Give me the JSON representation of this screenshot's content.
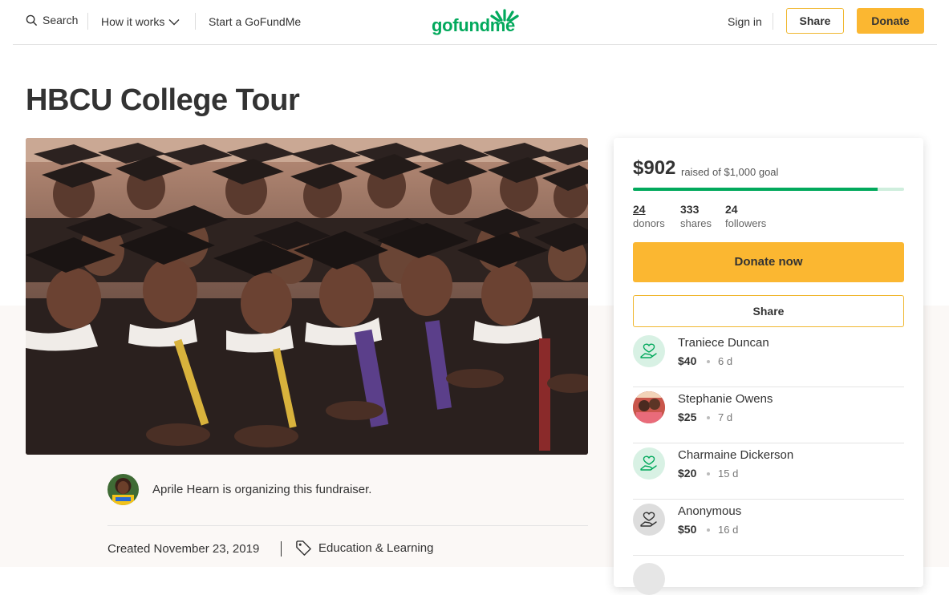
{
  "header": {
    "search_label": "Search",
    "how_it_works_label": "How it works",
    "start_label": "Start a GoFundMe",
    "logo_text": "gofundme",
    "sign_in_label": "Sign in",
    "share_label": "Share",
    "donate_label": "Donate"
  },
  "campaign": {
    "title": "HBCU College Tour",
    "organizer_text": "Aprile Hearn is organizing this fundraiser.",
    "created": "Created November 23, 2019",
    "category": "Education & Learning"
  },
  "sidebar": {
    "raised_amount": "$902",
    "raised_of": "raised of $1,000 goal",
    "progress_fraction": 0.902,
    "stats": {
      "donors_num": "24",
      "donors_label": "donors",
      "shares_num": "333",
      "shares_label": "shares",
      "followers_num": "24",
      "followers_label": "followers"
    },
    "donate_now_label": "Donate now",
    "share_label": "Share",
    "donations": [
      {
        "name": "Traniece Duncan",
        "amount": "$40",
        "time": "6 d",
        "avatar": "heart-hand-icon"
      },
      {
        "name": "Stephanie Owens",
        "amount": "$25",
        "time": "7 d",
        "avatar": "photo"
      },
      {
        "name": "Charmaine Dickerson",
        "amount": "$20",
        "time": "15 d",
        "avatar": "heart-hand-icon"
      },
      {
        "name": "Anonymous",
        "amount": "$50",
        "time": "16 d",
        "avatar": "heart-hand-icon"
      }
    ]
  },
  "colors": {
    "brand_green": "#02a95c",
    "accent_yellow": "#fbb731",
    "text": "#333333"
  }
}
